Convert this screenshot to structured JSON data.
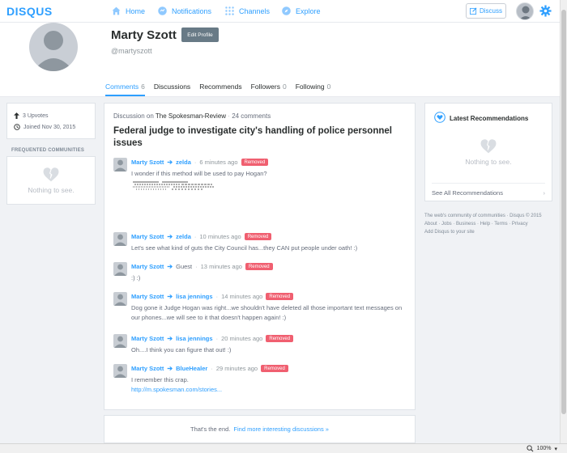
{
  "brand": "DISQUS",
  "nav": {
    "home": "Home",
    "notifications": "Notifications",
    "channels": "Channels",
    "explore": "Explore",
    "discuss": "Discuss"
  },
  "profile": {
    "name": "Marty Szott",
    "edit_label": "Edit Profile",
    "handle": "@martyszott"
  },
  "tabs": [
    {
      "label": "Comments",
      "count": "6"
    },
    {
      "label": "Discussions",
      "count": ""
    },
    {
      "label": "Recommends",
      "count": ""
    },
    {
      "label": "Followers",
      "count": "0"
    },
    {
      "label": "Following",
      "count": "0"
    }
  ],
  "stats": {
    "upvotes": "3 Upvotes",
    "joined": "Joined Nov 30, 2015"
  },
  "communities": {
    "heading": "FREQUENTED COMMUNITIES",
    "empty": "Nothing to see."
  },
  "discussion": {
    "prefix": "Discussion on",
    "forum": "The Spokesman-Review",
    "separator": "·",
    "comment_count": "24 comments",
    "title": "Federal judge to investigate city's handling of police personnel issues"
  },
  "comments": [
    {
      "author": "Marty Szott",
      "reply_to": "zelda",
      "time": "6 minutes ago",
      "status": "Removed",
      "body": "I wonder if this method will be used to pay Hogan?",
      "link": ""
    },
    {
      "author": "Marty Szott",
      "reply_to": "zelda",
      "time": "10 minutes ago",
      "status": "Removed",
      "body": "Let's see what kind of guts the City Council has...they CAN put people under oath! :)",
      "link": ""
    },
    {
      "author": "Marty Szott",
      "reply_to": "Guest",
      "time": "13 minutes ago",
      "status": "Removed",
      "body": ":) :)",
      "link": ""
    },
    {
      "author": "Marty Szott",
      "reply_to": "lisa jennings",
      "time": "14 minutes ago",
      "status": "Removed",
      "body": "Dog gone it Judge Hogan was right...we shouldn't have deleted all those important text messages on our phones...we will see to it that doesn't happen again! :)",
      "link": ""
    },
    {
      "author": "Marty Szott",
      "reply_to": "lisa jennings",
      "time": "20 minutes ago",
      "status": "Removed",
      "body": "Oh....I think you can figure that out! :)",
      "link": ""
    },
    {
      "author": "Marty Szott",
      "reply_to": "BlueHealer",
      "time": "29 minutes ago",
      "status": "Removed",
      "body": "I remember this crap.",
      "link": "http://m.spokesman.com/stories..."
    }
  ],
  "end": {
    "text": "That's the end.",
    "link": "Find more interesting discussions »"
  },
  "recommendations": {
    "title": "Latest Recommendations",
    "empty": "Nothing to see.",
    "see_all": "See All Recommendations",
    "chevron": "›"
  },
  "footer": {
    "line1": "The web's community of communities · Disqus © 2015",
    "line2": "About · Jobs · Business · Help · Terms · Privacy",
    "line3": "Add Disqus to your site"
  },
  "statusbar": {
    "zoom": "100%"
  },
  "colors": {
    "accent": "#2e9fff",
    "removed": "#f05f70",
    "edit_button": "#687a86"
  }
}
